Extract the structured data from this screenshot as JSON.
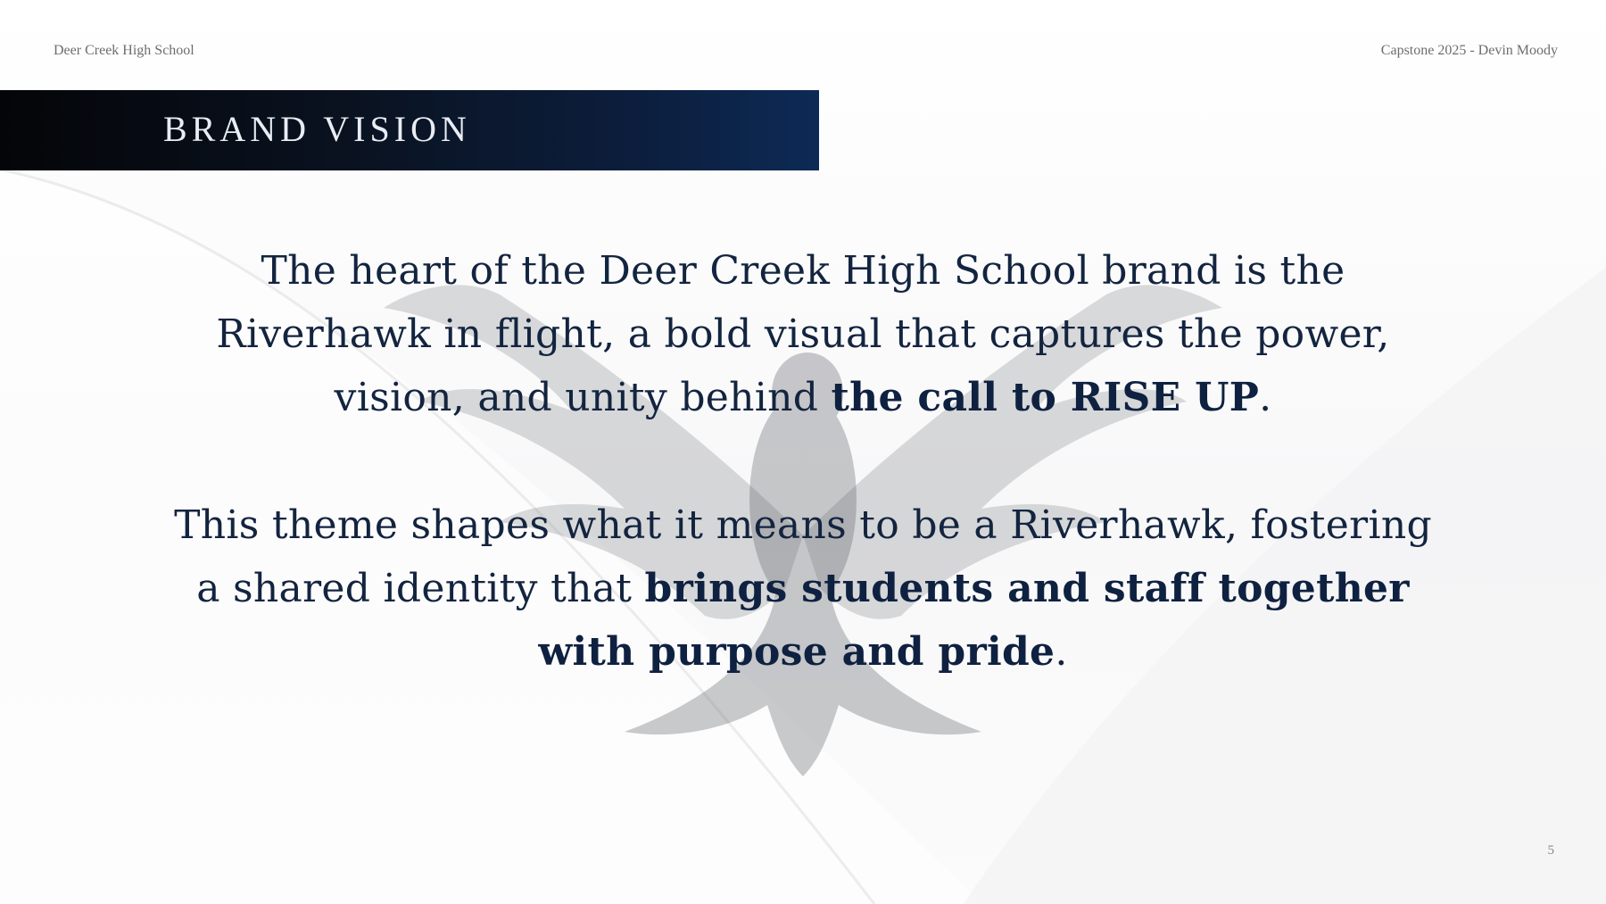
{
  "header": {
    "school": "Deer Creek High School",
    "capstone": "Capstone 2025 - Devin Moody"
  },
  "title": "BRAND VISION",
  "paragraph1": {
    "text": "The heart of the Deer Creek High School brand is the Riverhawk in flight, a bold visual that captures the power, vision, and unity behind ",
    "emphasis": "the call to RISE UP",
    "end": "."
  },
  "paragraph2": {
    "text": "This theme shapes what it means to be a Riverhawk, fostering a shared identity that ",
    "emphasis": "brings students and staff together with purpose and pride",
    "end": "."
  },
  "page_number": "5",
  "colors": {
    "banner_dark": "#040508",
    "banner_navy": "#0d2a55",
    "text_navy": "#13243f"
  },
  "icons": [
    "riverhawk-emblem"
  ]
}
